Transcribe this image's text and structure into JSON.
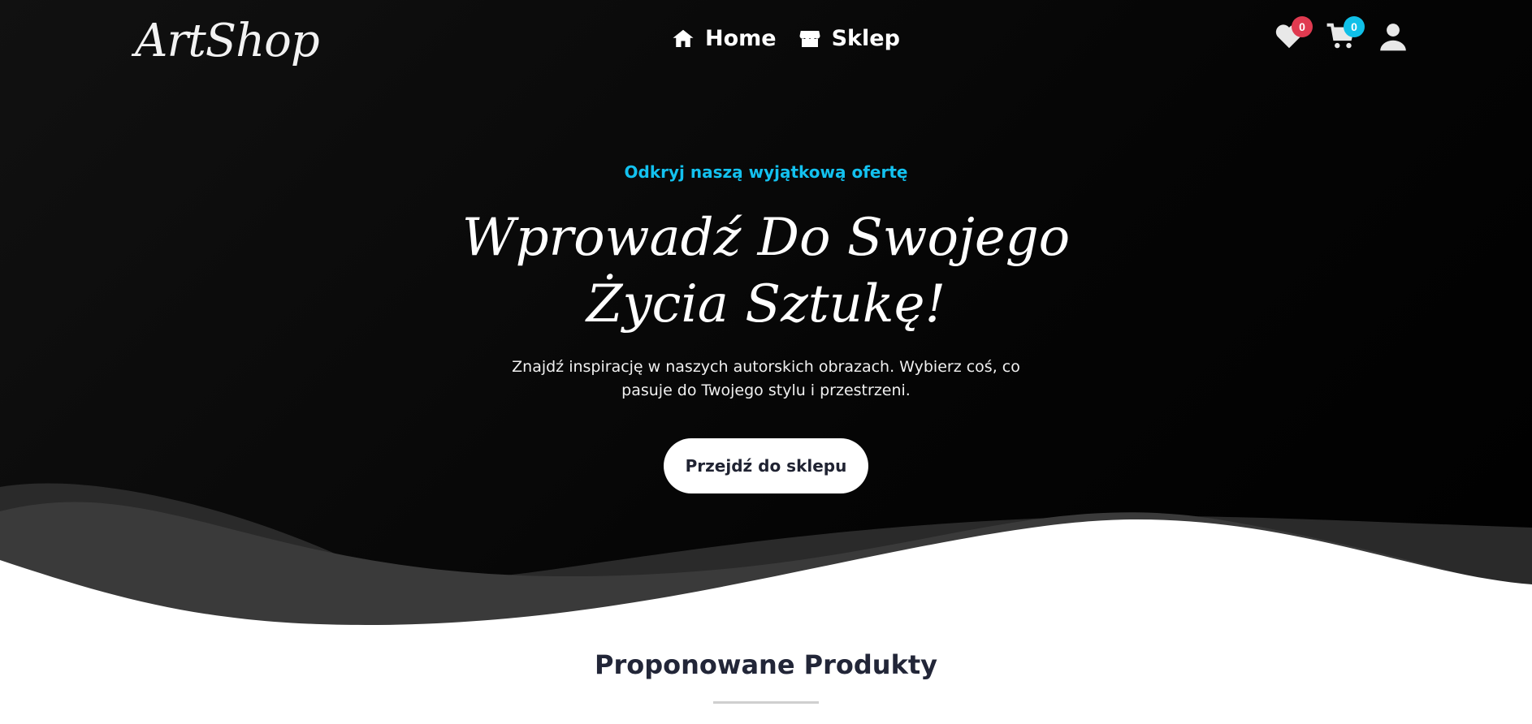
{
  "header": {
    "logo": "ArtShop",
    "nav": [
      {
        "label": "Home",
        "icon": "home-icon"
      },
      {
        "label": "Sklep",
        "icon": "store-icon"
      }
    ],
    "wishlist": {
      "icon": "heart-icon",
      "count": "0",
      "badge_color": "#e03a50"
    },
    "cart": {
      "icon": "cart-icon",
      "count": "0",
      "badge_color": "#10c0e8"
    },
    "account": {
      "icon": "user-icon"
    }
  },
  "hero": {
    "eyebrow": "Odkryj naszą wyjątkową ofertę",
    "title": "Wprowadź Do Swojego Życia Sztukę!",
    "text": "Znajdź inspirację w naszych autorskich obrazach. Wybierz coś, co pasuje do Twojego stylu i przestrzeni.",
    "button": "Przejdź do sklepu",
    "accent_color": "#13c1ef",
    "background": "#0a0a0a"
  },
  "featured": {
    "title": "Proponowane Produkty"
  }
}
